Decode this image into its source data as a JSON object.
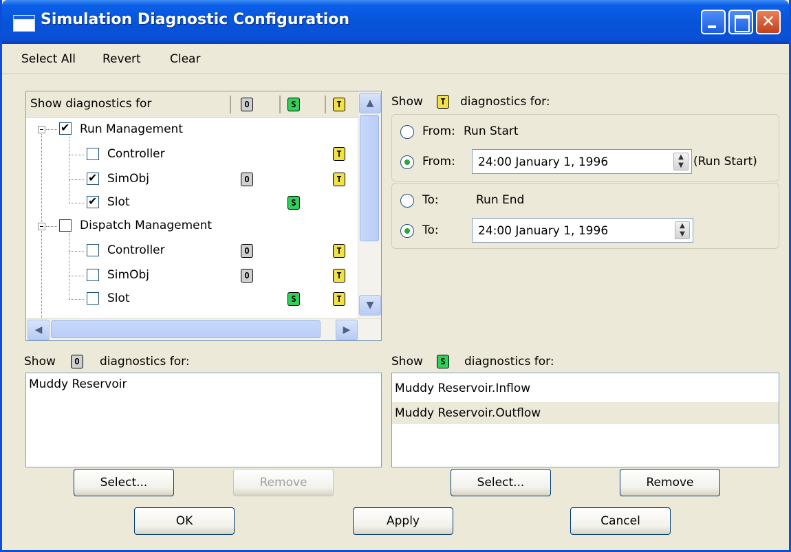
{
  "window": {
    "title": "Simulation Diagnostic Configuration"
  },
  "menu": [
    "Select All",
    "Revert",
    "Clear"
  ],
  "tree": {
    "header": "Show diagnostics for",
    "col_badges": [
      "O",
      "S",
      "T"
    ],
    "groups": [
      {
        "label": "Run Management",
        "checked": true,
        "children": [
          {
            "label": "Controller",
            "checked": false
          },
          {
            "label": "SimObj",
            "checked": true
          },
          {
            "label": "Slot",
            "checked": true
          }
        ]
      },
      {
        "label": "Dispatch Management",
        "checked": false,
        "children": [
          {
            "label": "Controller",
            "checked": false
          },
          {
            "label": "SimObj",
            "checked": false
          },
          {
            "label": "Slot",
            "checked": false
          }
        ]
      }
    ]
  },
  "timing": {
    "show": "Show",
    "diag_for": "diagnostics for:",
    "badge": "T",
    "from_start": {
      "label": "From:",
      "value": "Run Start"
    },
    "from_date": {
      "label": "From:",
      "value": "24:00 January 1, 1996",
      "suffix": "(Run Start)"
    },
    "to_end": {
      "label": "To:",
      "value": "Run End"
    },
    "to_date": {
      "label": "To:",
      "value": "24:00 January 1, 1996"
    }
  },
  "object_section": {
    "show": "Show",
    "badge": "O",
    "diag_for": "diagnostics for:",
    "items": [
      "Muddy Reservoir"
    ],
    "select_label": "Select...",
    "remove_label": "Remove"
  },
  "slot_section": {
    "show": "Show",
    "badge": "S",
    "diag_for": "diagnostics for:",
    "items": [
      "Muddy Reservoir.Inflow",
      "Muddy Reservoir.Outflow"
    ],
    "select_label": "Select...",
    "remove_label": "Remove"
  },
  "footer": {
    "ok": "OK",
    "apply": "Apply",
    "cancel": "Cancel"
  },
  "colors": {
    "title_blue": "#0a4fd6",
    "panel_bg": "#ece9d8",
    "badge_o": "#d0d0d0",
    "badge_s": "#2fd15a",
    "badge_t": "#f2e04a"
  },
  "icons": [
    "window-icon",
    "minimize-icon",
    "maximize-icon",
    "close-icon",
    "up-arrow-icon",
    "down-arrow-icon",
    "left-arrow-icon",
    "right-arrow-icon"
  ]
}
